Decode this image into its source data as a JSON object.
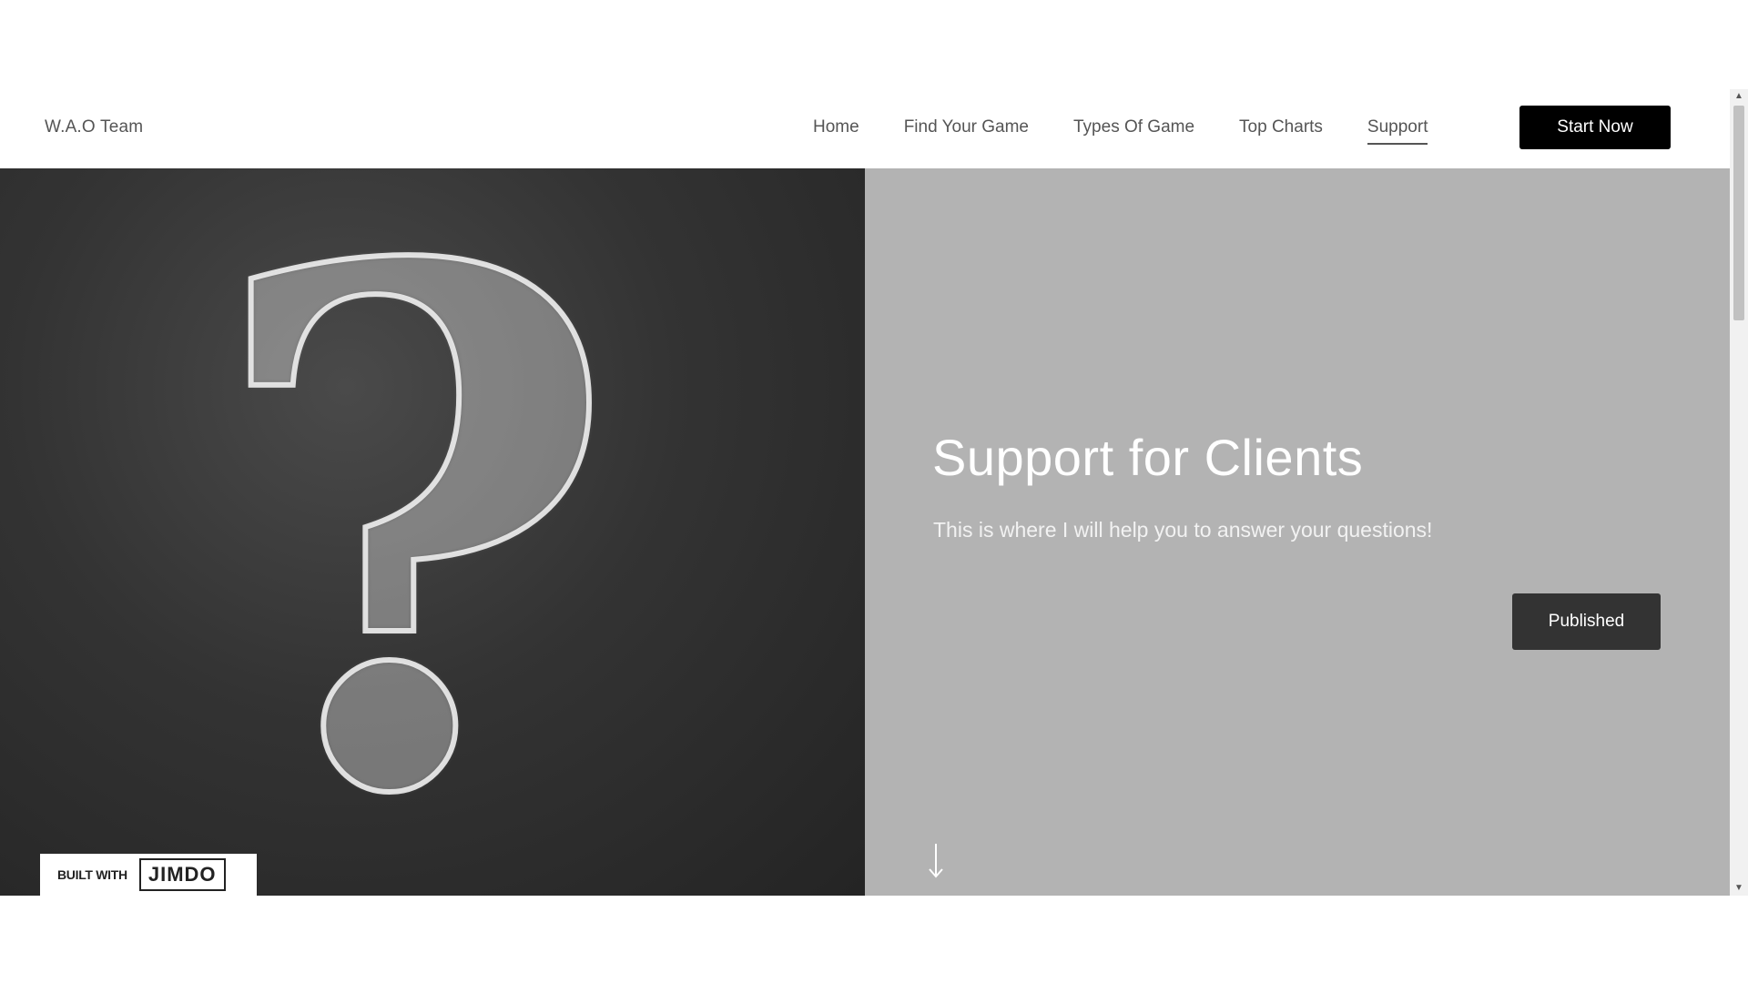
{
  "header": {
    "brand": "W.A.O Team",
    "nav": [
      {
        "label": "Home",
        "active": false
      },
      {
        "label": "Find Your Game",
        "active": false
      },
      {
        "label": "Types Of Game",
        "active": false
      },
      {
        "label": "Top Charts",
        "active": false
      },
      {
        "label": "Support",
        "active": true
      }
    ],
    "cta_label": "Start Now"
  },
  "hero": {
    "image_glyph": "?",
    "title": "Support for Clients",
    "subtitle": "This is where I will help you to answer your questions!",
    "button_label": "Published",
    "scroll_icon": "arrow-down-icon"
  },
  "badge": {
    "prefix": "BUILT WITH",
    "logo": "JIMDO"
  },
  "colors": {
    "accent_button": "#000000",
    "published_button": "#333333",
    "right_panel": "#b3b3b3",
    "nav_text": "#555555"
  },
  "scrollbar": {
    "up_icon": "▲",
    "down_icon": "▼"
  }
}
